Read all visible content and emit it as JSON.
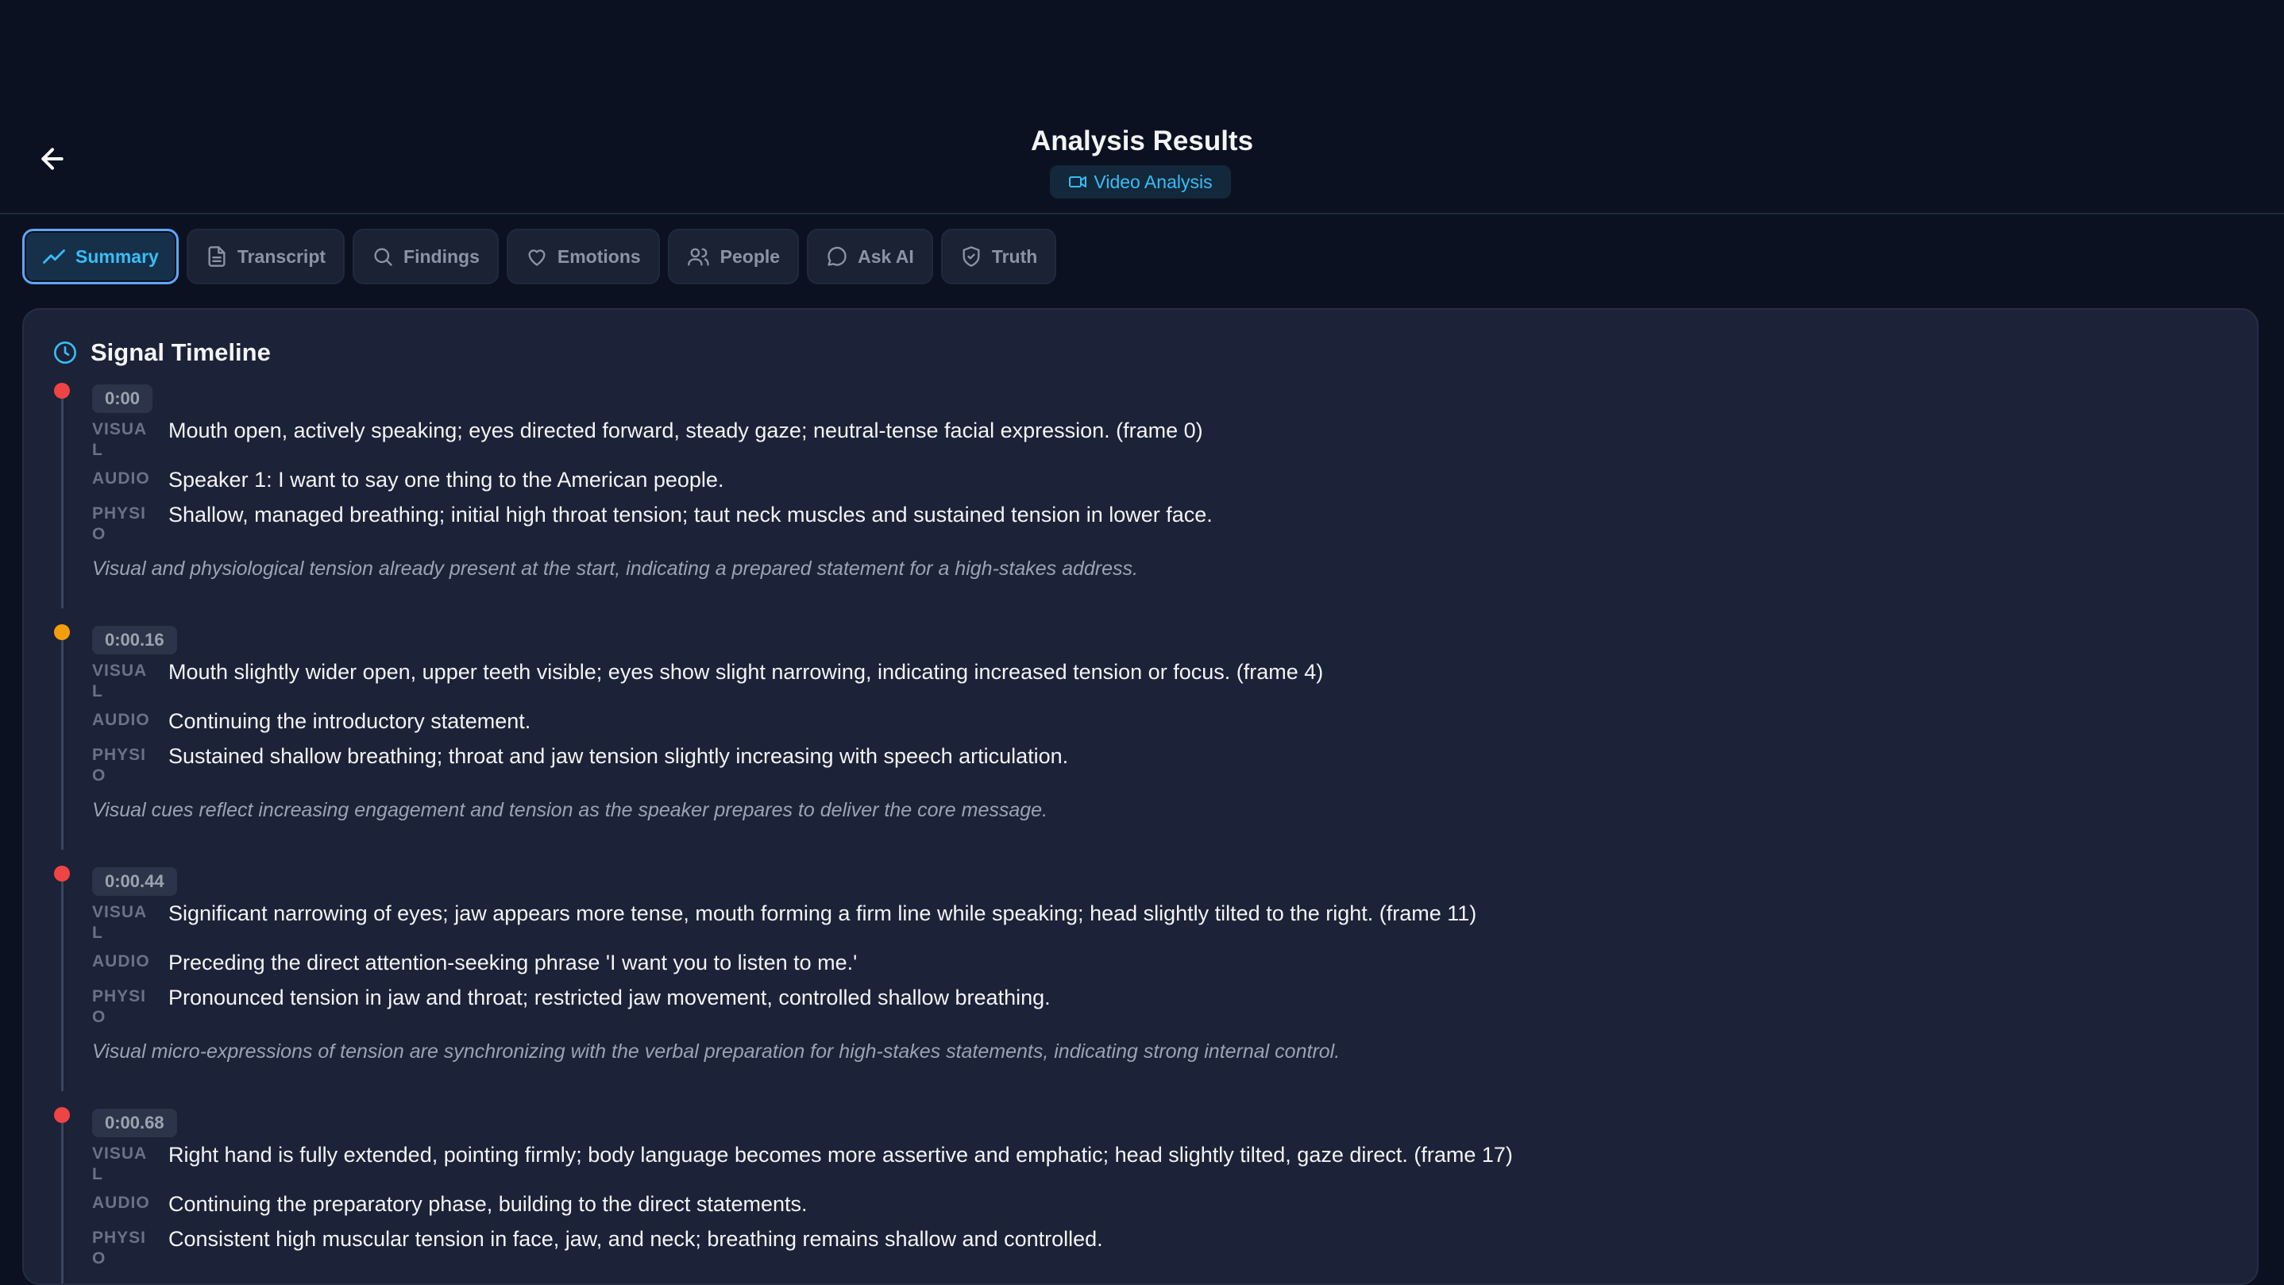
{
  "header": {
    "title": "Analysis Results",
    "badge_label": "Video Analysis"
  },
  "tabs": [
    {
      "label": "Summary",
      "icon": "trend-line-icon",
      "active": true
    },
    {
      "label": "Transcript",
      "icon": "document-icon",
      "active": false
    },
    {
      "label": "Findings",
      "icon": "search-icon",
      "active": false
    },
    {
      "label": "Emotions",
      "icon": "heart-icon",
      "active": false
    },
    {
      "label": "People",
      "icon": "people-icon",
      "active": false
    },
    {
      "label": "Ask AI",
      "icon": "chat-bubble-icon",
      "active": false
    },
    {
      "label": "Truth",
      "icon": "shield-check-icon",
      "active": false
    }
  ],
  "timeline": {
    "title": "Signal Timeline",
    "labels": {
      "visual": "VISUAL",
      "audio": "AUDIO",
      "physio": "PHYSIO"
    },
    "entries": [
      {
        "time": "0:00",
        "dot_color": "#ef4444",
        "visual": "Mouth open, actively speaking; eyes directed forward, steady gaze; neutral-tense facial expression. (frame 0)",
        "audio": "Speaker 1: I want to say one thing to the American people.",
        "physio": "Shallow, managed breathing; initial high throat tension; taut neck muscles and sustained tension in lower face.",
        "note": "Visual and physiological tension already present at the start, indicating a prepared statement for a high-stakes address."
      },
      {
        "time": "0:00.16",
        "dot_color": "#f59e0b",
        "visual": "Mouth slightly wider open, upper teeth visible; eyes show slight narrowing, indicating increased tension or focus. (frame 4)",
        "audio": "Continuing the introductory statement.",
        "physio": "Sustained shallow breathing; throat and jaw tension slightly increasing with speech articulation.",
        "note": "Visual cues reflect increasing engagement and tension as the speaker prepares to deliver the core message."
      },
      {
        "time": "0:00.44",
        "dot_color": "#ef4444",
        "visual": "Significant narrowing of eyes; jaw appears more tense, mouth forming a firm line while speaking; head slightly tilted to the right. (frame 11)",
        "audio": "Preceding the direct attention-seeking phrase 'I want you to listen to me.'",
        "physio": "Pronounced tension in jaw and throat; restricted jaw movement, controlled shallow breathing.",
        "note": "Visual micro-expressions of tension are synchronizing with the verbal preparation for high-stakes statements, indicating strong internal control."
      },
      {
        "time": "0:00.68",
        "dot_color": "#ef4444",
        "visual": "Right hand is fully extended, pointing firmly; body language becomes more assertive and emphatic; head slightly tilted, gaze direct. (frame 17)",
        "audio": "Continuing the preparatory phase, building to the direct statements.",
        "physio": "Consistent high muscular tension in face, jaw, and neck; breathing remains shallow and controlled.",
        "note": ""
      }
    ]
  }
}
